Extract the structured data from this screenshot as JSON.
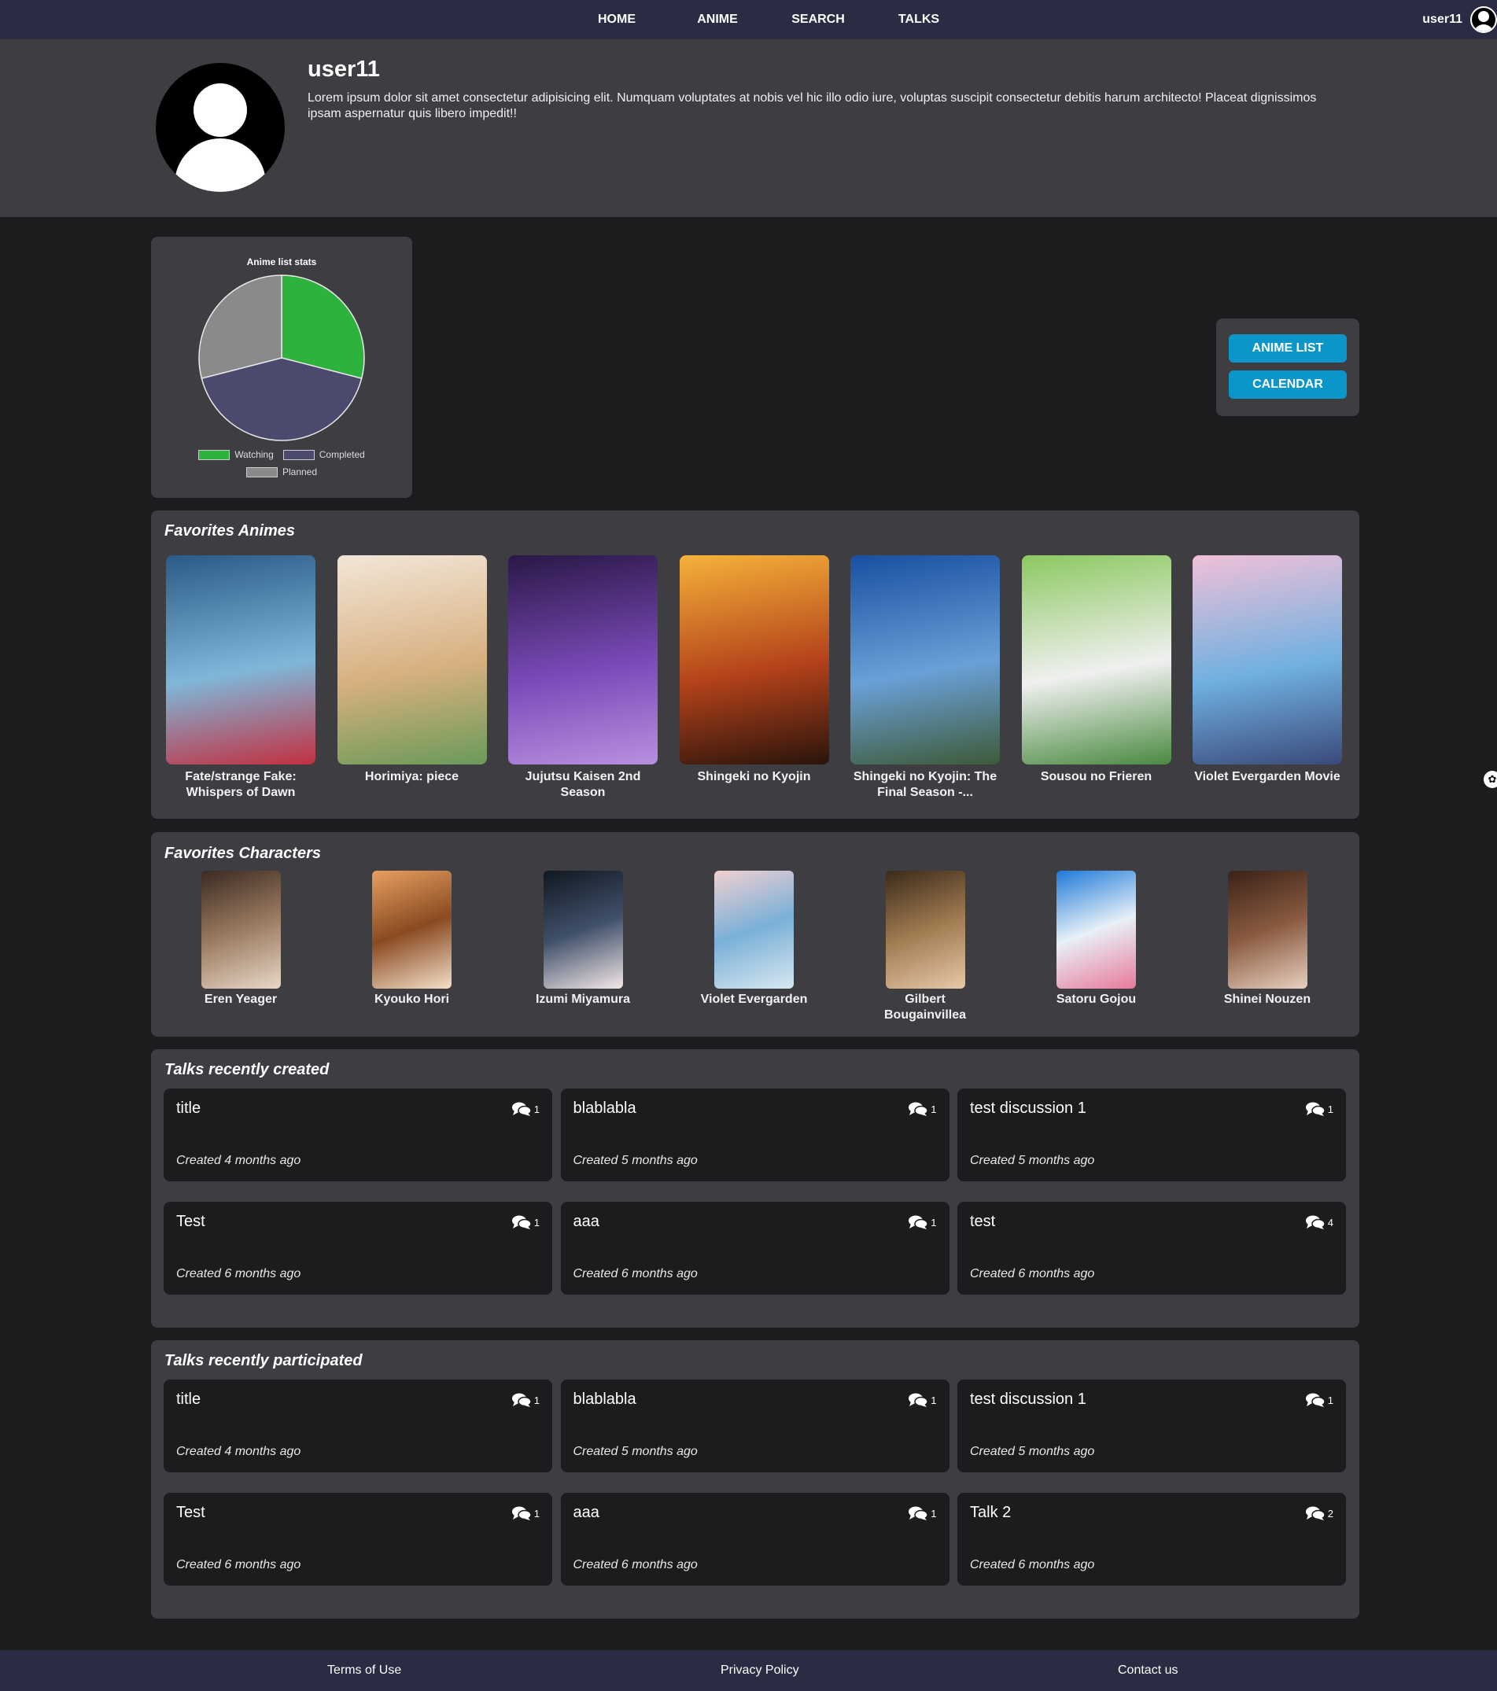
{
  "nav": {
    "links": [
      "HOME",
      "ANIME",
      "SEARCH",
      "TALKS"
    ],
    "username": "user11"
  },
  "profile": {
    "username": "user11",
    "bio": "Lorem ipsum dolor sit amet consectetur adipisicing elit. Numquam voluptates at nobis vel hic illo odio iure, voluptas suscipit consectetur debitis harum architecto! Placeat dignissimos ipsam aspernatur quis libero impedit!!"
  },
  "chart_data": {
    "type": "pie",
    "title": "Anime list stats",
    "categories": [
      "Watching",
      "Completed",
      "Planned"
    ],
    "values": [
      29,
      42,
      29
    ],
    "colors": [
      "#2db33d",
      "#4b4a6e",
      "#8a8a8a"
    ],
    "legend": "bottom"
  },
  "side_buttons": {
    "anime_list": "ANIME LIST",
    "calendar": "CALENDAR"
  },
  "favorites_animes": {
    "title": "Favorites Animes",
    "items": [
      {
        "name": "Fate/strange Fake: Whispers of Dawn",
        "colors": [
          "#2a5a86",
          "#7fb7d9",
          "#c23040"
        ]
      },
      {
        "name": "Horimiya: piece",
        "colors": [
          "#f2e6d8",
          "#d8b080",
          "#6a9a58"
        ]
      },
      {
        "name": "Jujutsu Kaisen 2nd Season",
        "colors": [
          "#2a1846",
          "#7a4ab8",
          "#b890e0"
        ]
      },
      {
        "name": "Shingeki no Kyojin",
        "colors": [
          "#f5b23a",
          "#b4421a",
          "#2a140c"
        ]
      },
      {
        "name": "Shingeki no Kyojin: The Final Season -...",
        "colors": [
          "#1a4fa0",
          "#6aa0d8",
          "#3e5a38"
        ]
      },
      {
        "name": "Sousou no Frieren",
        "colors": [
          "#8cc860",
          "#f0f0f0",
          "#4a8a40"
        ]
      },
      {
        "name": "Violet Evergarden Movie",
        "colors": [
          "#f0c0d8",
          "#70b0e0",
          "#3a4a7a"
        ]
      }
    ]
  },
  "favorites_characters": {
    "title": "Favorites Characters",
    "items": [
      {
        "name": "Eren Yeager",
        "colors": [
          "#3a2a22",
          "#9a7a60",
          "#e8d8c8"
        ]
      },
      {
        "name": "Kyouko Hori",
        "colors": [
          "#e8a060",
          "#8a4a22",
          "#f4e0c8"
        ]
      },
      {
        "name": "Izumi Miyamura",
        "colors": [
          "#101820",
          "#40506a",
          "#f4e8e8"
        ]
      },
      {
        "name": "Violet Evergarden",
        "colors": [
          "#f0d0d0",
          "#7ab0d8",
          "#d8e8f0"
        ]
      },
      {
        "name": "Gilbert Bougainvillea",
        "colors": [
          "#3a2a1a",
          "#a07a50",
          "#e8c8a8"
        ]
      },
      {
        "name": "Satoru Gojou",
        "colors": [
          "#1e7ad8",
          "#e8f0f8",
          "#e87a9a"
        ]
      },
      {
        "name": "Shinei Nouzen",
        "colors": [
          "#3a2218",
          "#8a5a40",
          "#e8d0c0"
        ]
      }
    ]
  },
  "talks_created": {
    "title": "Talks recently created",
    "items": [
      {
        "title": "title",
        "count": "1",
        "date": "Created 4 months ago"
      },
      {
        "title": "blablabla",
        "count": "1",
        "date": "Created 5 months ago"
      },
      {
        "title": "test discussion 1",
        "count": "1",
        "date": "Created 5 months ago"
      },
      {
        "title": "Test",
        "count": "1",
        "date": "Created 6 months ago"
      },
      {
        "title": "aaa",
        "count": "1",
        "date": "Created 6 months ago"
      },
      {
        "title": "test",
        "count": "4",
        "date": "Created 6 months ago"
      }
    ]
  },
  "talks_participated": {
    "title": "Talks recently participated",
    "items": [
      {
        "title": "title",
        "count": "1",
        "date": "Created 4 months ago"
      },
      {
        "title": "blablabla",
        "count": "1",
        "date": "Created 5 months ago"
      },
      {
        "title": "test discussion 1",
        "count": "1",
        "date": "Created 5 months ago"
      },
      {
        "title": "Test",
        "count": "1",
        "date": "Created 6 months ago"
      },
      {
        "title": "aaa",
        "count": "1",
        "date": "Created 6 months ago"
      },
      {
        "title": "Talk 2",
        "count": "2",
        "date": "Created 6 months ago"
      }
    ]
  },
  "footer": {
    "terms": "Terms of Use",
    "privacy": "Privacy Policy",
    "contact": "Contact us"
  }
}
